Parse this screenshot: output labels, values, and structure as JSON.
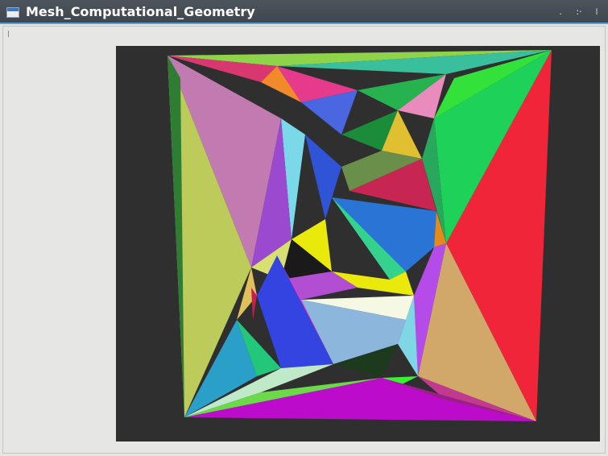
{
  "window": {
    "title": "Mesh_Computational_Geometry",
    "controls": [
      {
        "name": "minimize",
        "glyph": "."
      },
      {
        "name": "maximize",
        "glyph": ":·"
      },
      {
        "name": "close",
        "glyph": "⁞"
      }
    ]
  },
  "mesh": {
    "description_colors": [
      "#c27bb0",
      "#bccb5a",
      "#f0253a",
      "#1ed158",
      "#bc0bcb",
      "#d2a86a",
      "#2a74d6",
      "#f5f8e2",
      "#8db6dc",
      "#e9e90b",
      "#ff2ec6",
      "#3344e0",
      "#3af033",
      "#c72652"
    ]
  }
}
